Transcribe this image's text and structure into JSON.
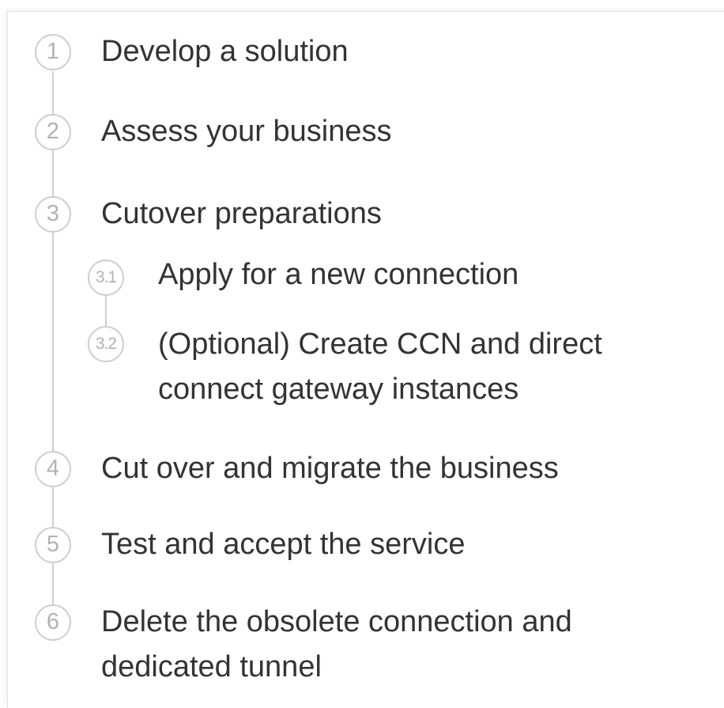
{
  "steps": [
    {
      "number": "1",
      "label": "Develop a solution"
    },
    {
      "number": "2",
      "label": "Assess your business"
    },
    {
      "number": "3",
      "label": "Cutover preparations",
      "substeps": [
        {
          "number": "3.1",
          "label": "Apply for a new connection"
        },
        {
          "number": "3.2",
          "label_line1": "(Optional) Create CCN and direct",
          "label_line2": "connect gateway instances"
        }
      ]
    },
    {
      "number": "4",
      "label": "Cut over and migrate the business"
    },
    {
      "number": "5",
      "label": "Test and accept the service"
    },
    {
      "number": "6",
      "label_line1": "Delete the obsolete connection and",
      "label_line2": "dedicated tunnel"
    }
  ]
}
